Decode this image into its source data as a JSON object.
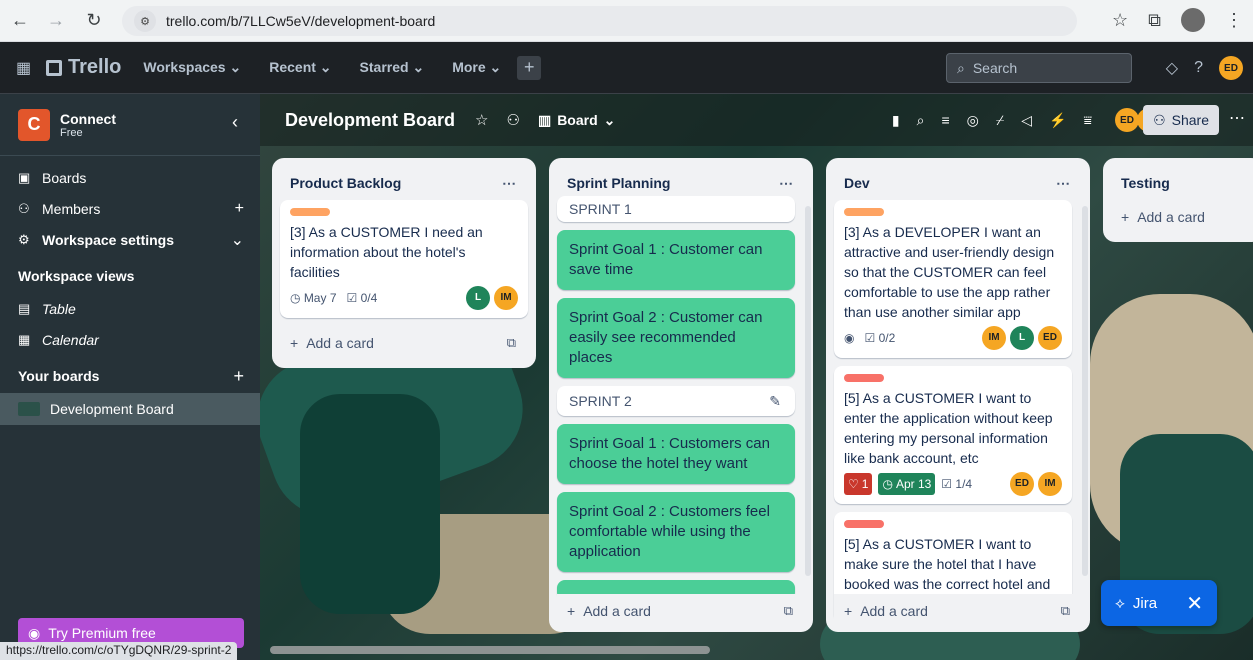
{
  "browser": {
    "url": "trello.com/b/7LLCw5eV/development-board",
    "status_url": "https://trello.com/c/oTYgDQNR/29-sprint-2"
  },
  "header": {
    "logo": "Trello",
    "menus": [
      "Workspaces",
      "Recent",
      "Starred",
      "More"
    ],
    "search_placeholder": "Search",
    "user_initials": "ED"
  },
  "sidebar": {
    "workspace_initial": "C",
    "workspace_name": "Connect",
    "workspace_plan": "Free",
    "items": [
      {
        "label": "Boards",
        "icon": "board-icon"
      },
      {
        "label": "Members",
        "icon": "members-icon"
      },
      {
        "label": "Workspace settings",
        "icon": "settings-icon"
      }
    ],
    "views_heading": "Workspace views",
    "views": [
      {
        "label": "Table",
        "icon": "table-icon"
      },
      {
        "label": "Calendar",
        "icon": "calendar-icon"
      }
    ],
    "boards_heading": "Your boards",
    "active_board": "Development Board",
    "premium": "Try Premium free"
  },
  "board": {
    "title": "Development Board",
    "view": "Board",
    "share": "Share",
    "members": [
      "ED",
      "IM",
      "L"
    ]
  },
  "lists": [
    {
      "title": "Product Backlog",
      "cards": [
        {
          "label_color": "#fea362",
          "text": "[3] As a CUSTOMER I need an information about the hotel's facilities",
          "due": "May 7",
          "checklist": "0/4",
          "members": [
            "L",
            "IM"
          ]
        }
      ],
      "add": "Add a card"
    },
    {
      "title": "Sprint Planning",
      "sections": [
        "SPRINT 1",
        "SPRINT 2"
      ],
      "goals_s1": [
        "Sprint Goal 1 : Customer can save time",
        "Sprint Goal 2 : Customer can easily see recommended places"
      ],
      "goals_s2": [
        "Sprint Goal 1 : Customers can choose the hotel they want",
        "Sprint Goal 2 : Customers feel comfortable while using the application"
      ],
      "add": "Add a card"
    },
    {
      "title": "Dev",
      "cards": [
        {
          "label_color": "#fea362",
          "text": "[3] As a DEVELOPER I want an attractive and user-friendly design so that the CUSTOMER can feel comfortable to use the app rather than use another similar app",
          "checklist": "0/2",
          "members": [
            "IM",
            "L",
            "ED"
          ]
        },
        {
          "label_color": "#f87168",
          "text": "[5] As a CUSTOMER I want to enter the application without keep entering my personal information like bank account, etc",
          "notif": "1",
          "due": "Apr 13",
          "checklist": "1/4",
          "members": [
            "ED",
            "IM"
          ]
        },
        {
          "label_color": "#f87168",
          "text": "[5] As a CUSTOMER I want to make sure the hotel that I have booked was the correct hotel and the"
        }
      ],
      "add": "Add a card"
    },
    {
      "title": "Testing",
      "add": "Add a card"
    }
  ],
  "jira": {
    "label": "Jira"
  }
}
